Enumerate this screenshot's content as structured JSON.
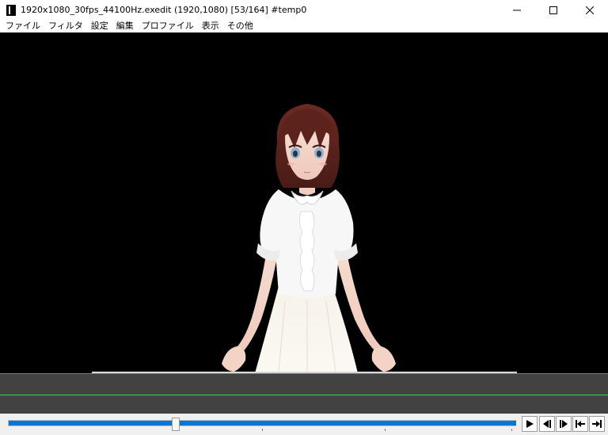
{
  "window": {
    "title": "1920x1080_30fps_44100Hz.exedit (1920,1080)  [53/164]  #temp0",
    "minimize_icon": "minimize-icon",
    "maximize_icon": "maximize-icon",
    "close_icon": "close-icon"
  },
  "menu": {
    "items": [
      {
        "label": "ファイル"
      },
      {
        "label": "フィルタ"
      },
      {
        "label": "設定"
      },
      {
        "label": "編集"
      },
      {
        "label": "プロファイル"
      },
      {
        "label": "表示"
      },
      {
        "label": "その他"
      }
    ]
  },
  "preview": {
    "content": "anime character in white blouse on black background"
  },
  "playback": {
    "frame_current": 53,
    "frame_total": 164,
    "progress_fraction": 0.3232,
    "controls": [
      {
        "name": "play-button",
        "icon": "play-icon"
      },
      {
        "name": "prev-frame-button",
        "icon": "step-back-icon"
      },
      {
        "name": "next-frame-button",
        "icon": "step-forward-icon"
      },
      {
        "name": "go-start-button",
        "icon": "skip-start-icon"
      },
      {
        "name": "go-end-button",
        "icon": "skip-end-icon"
      }
    ]
  },
  "colors": {
    "seek_fill": "#0078d7",
    "timeline_bg": "#424242",
    "timeline_line": "#3fd93f",
    "preview_bg": "#000000"
  }
}
